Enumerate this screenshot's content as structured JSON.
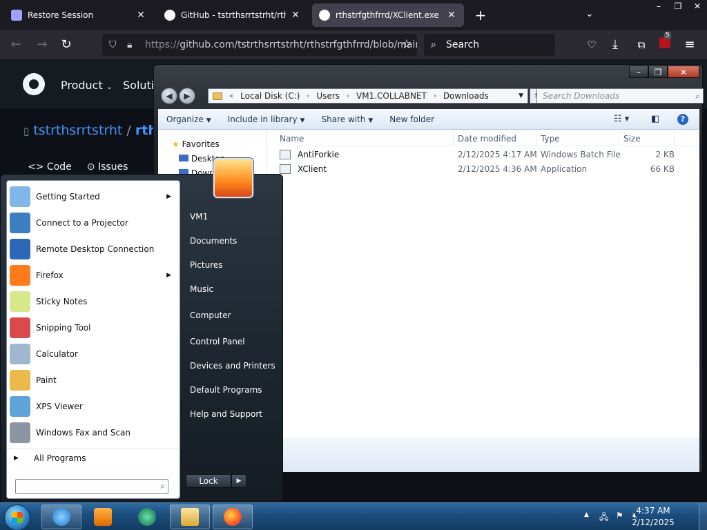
{
  "firefox": {
    "tabs": [
      {
        "title": "Restore Session",
        "close": "✕"
      },
      {
        "title": "GitHub - tstrthsrrtstrht/rthstrfgthfrrd",
        "close": "✕"
      },
      {
        "title": "rthstrfgthfrrd/XClient.exe at main",
        "close": "✕"
      }
    ],
    "new_tab": "+",
    "list_tabs": "⌄",
    "url_protocol": "https://",
    "url": "github.com/tstrthsrrtstrht/rthstrfgthfrrd/blob/main/",
    "search_placeholder": "Search",
    "extension_badge": "5"
  },
  "github": {
    "nav": [
      "Product",
      "Solutions"
    ],
    "repo_owner": "tstrthsrrtstrht",
    "repo_sep": "/",
    "repo_name": "rthstrfgthfrrd",
    "tabs": [
      "Code",
      "Issues"
    ]
  },
  "explorer": {
    "window_controls": [
      "–",
      "❐",
      "✕"
    ],
    "address": [
      "Local Disk (C:)",
      "Users",
      "VM1.COLLABNET",
      "Downloads"
    ],
    "search_placeholder": "Search Downloads",
    "toolbar": {
      "organize": "Organize",
      "include": "Include in library",
      "share": "Share with",
      "new_folder": "New folder"
    },
    "nav_pane": {
      "favorites": "Favorites",
      "desktop": "Desktop",
      "downloads": "Downloads"
    },
    "columns": [
      "Name",
      "Date modified",
      "Type",
      "Size"
    ],
    "files": [
      {
        "name": "AntiForkie",
        "date": "2/12/2025 4:17 AM",
        "type": "Windows Batch File",
        "size": "2 KB"
      },
      {
        "name": "XClient",
        "date": "2/12/2025 4:36 AM",
        "type": "Application",
        "size": "66 KB"
      }
    ]
  },
  "start_menu": {
    "programs": [
      {
        "label": "Getting Started",
        "icon": "getting-started-icon",
        "color": "#7fb8e8",
        "submenu": true
      },
      {
        "label": "Connect to a Projector",
        "icon": "projector-icon",
        "color": "#3c7fc1",
        "submenu": false
      },
      {
        "label": "Remote Desktop Connection",
        "icon": "remote-desktop-icon",
        "color": "#2e66b8",
        "submenu": false
      },
      {
        "label": "Firefox",
        "icon": "firefox-icon",
        "color": "#ff7a1a",
        "submenu": true
      },
      {
        "label": "Sticky Notes",
        "icon": "sticky-notes-icon",
        "color": "#d6e88a",
        "submenu": false
      },
      {
        "label": "Snipping Tool",
        "icon": "snipping-tool-icon",
        "color": "#d94b4b",
        "submenu": false
      },
      {
        "label": "Calculator",
        "icon": "calculator-icon",
        "color": "#9fb7cf",
        "submenu": false
      },
      {
        "label": "Paint",
        "icon": "paint-icon",
        "color": "#e9b94a",
        "submenu": false
      },
      {
        "label": "XPS Viewer",
        "icon": "xps-viewer-icon",
        "color": "#5fa3d9",
        "submenu": false
      },
      {
        "label": "Windows Fax and Scan",
        "icon": "fax-scan-icon",
        "color": "#8c96a3",
        "submenu": false
      }
    ],
    "all_programs": "All Programs",
    "right_links": [
      "VM1",
      "Documents",
      "Pictures",
      "Music",
      "Computer",
      "Control Panel",
      "Devices and Printers",
      "Default Programs",
      "Help and Support"
    ],
    "lock": "Lock"
  },
  "taskbar": {
    "time": "4:37 AM",
    "date": "2/12/2025"
  }
}
